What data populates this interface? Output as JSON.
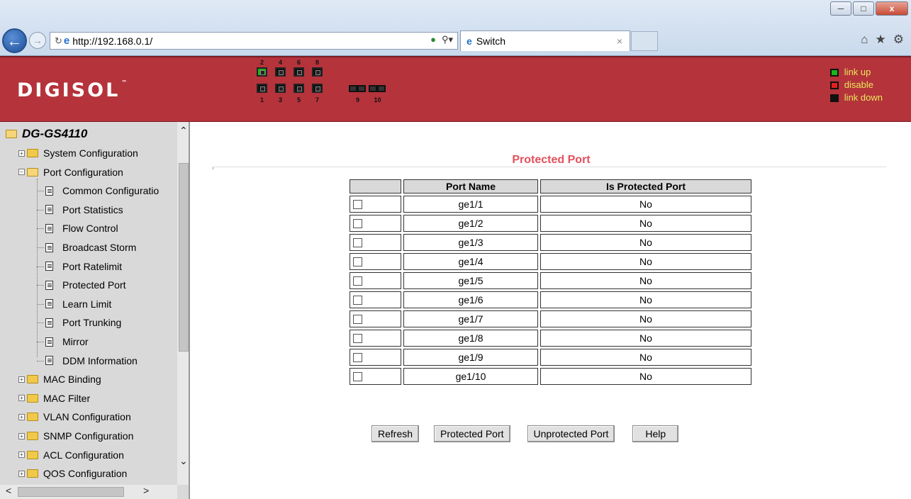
{
  "browser": {
    "url": "http://192.168.0.1/",
    "tab_title": "Switch",
    "window_controls": [
      "minimize-icon",
      "restore-icon",
      "close-icon"
    ]
  },
  "header": {
    "logo": "DIGISOL",
    "logo_tm": "™",
    "ports_top": [
      {
        "num": "2",
        "status": "up"
      },
      {
        "num": "4",
        "status": "down"
      },
      {
        "num": "6",
        "status": "down"
      },
      {
        "num": "8",
        "status": "down"
      }
    ],
    "ports_bottom": [
      {
        "num": "1",
        "status": "down"
      },
      {
        "num": "3",
        "status": "down"
      },
      {
        "num": "5",
        "status": "down"
      },
      {
        "num": "7",
        "status": "down"
      }
    ],
    "sfp_ports": [
      "9",
      "10"
    ],
    "legend": [
      {
        "label": "link up",
        "color": "#1bb51b"
      },
      {
        "label": "disable",
        "color": "#e02020"
      },
      {
        "label": "link down",
        "color": "#111111"
      }
    ]
  },
  "sidebar": {
    "root": "DG-GS4110",
    "items": [
      {
        "label": "System Configuration",
        "type": "folder",
        "expanded": false
      },
      {
        "label": "Port Configuration",
        "type": "folder",
        "expanded": true
      },
      {
        "label": "Common Configuratio",
        "type": "doc"
      },
      {
        "label": "Port Statistics",
        "type": "doc"
      },
      {
        "label": "Flow Control",
        "type": "doc"
      },
      {
        "label": "Broadcast Storm",
        "type": "doc"
      },
      {
        "label": "Port Ratelimit",
        "type": "doc"
      },
      {
        "label": "Protected Port",
        "type": "doc"
      },
      {
        "label": "Learn Limit",
        "type": "doc"
      },
      {
        "label": "Port Trunking",
        "type": "doc"
      },
      {
        "label": "Mirror",
        "type": "doc"
      },
      {
        "label": "DDM Information",
        "type": "doc"
      },
      {
        "label": "MAC Binding",
        "type": "folder",
        "expanded": false
      },
      {
        "label": "MAC Filter",
        "type": "folder",
        "expanded": false
      },
      {
        "label": "VLAN Configuration",
        "type": "folder",
        "expanded": false
      },
      {
        "label": "SNMP Configuration",
        "type": "folder",
        "expanded": false
      },
      {
        "label": "ACL Configuration",
        "type": "folder",
        "expanded": false
      },
      {
        "label": "QOS Configuration",
        "type": "folder",
        "expanded": false
      }
    ]
  },
  "main": {
    "title": "Protected Port",
    "columns": [
      "",
      "Port Name",
      "Is Protected Port"
    ],
    "rows": [
      {
        "port": "ge1/1",
        "protected": "No"
      },
      {
        "port": "ge1/2",
        "protected": "No"
      },
      {
        "port": "ge1/3",
        "protected": "No"
      },
      {
        "port": "ge1/4",
        "protected": "No"
      },
      {
        "port": "ge1/5",
        "protected": "No"
      },
      {
        "port": "ge1/6",
        "protected": "No"
      },
      {
        "port": "ge1/7",
        "protected": "No"
      },
      {
        "port": "ge1/8",
        "protected": "No"
      },
      {
        "port": "ge1/9",
        "protected": "No"
      },
      {
        "port": "ge1/10",
        "protected": "No"
      }
    ],
    "buttons": [
      "Refresh",
      "Protected Port",
      "Unprotected Port",
      "Help"
    ]
  }
}
